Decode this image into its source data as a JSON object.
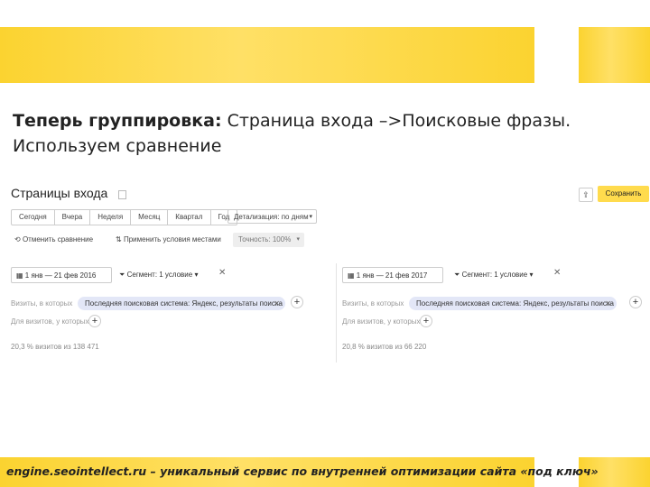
{
  "heading": {
    "bold": "Теперь группировка:",
    "rest": " Страница входа –>Поисковые фразы.",
    "line2": "Используем сравнение"
  },
  "report": {
    "title": "Страницы входа",
    "share_icon": "share-icon",
    "save_label": "Сохранить",
    "periods": [
      "Сегодня",
      "Вчера",
      "Неделя",
      "Месяц",
      "Квартал",
      "Год"
    ],
    "detail_select": "Детализация: по дням",
    "compare_label": "Отменить сравнение",
    "apply_label": "Применить условия местами",
    "accuracy_label": "Точность: 100%",
    "left": {
      "date": "1 янв — 21 фев 2016",
      "segment": "Сегмент: 1 условие",
      "visit_label": "Визиты, в которых",
      "chip": "Последняя поисковая система: Яндекс, результаты поиска",
      "visits_label": "Для визитов, у которых",
      "summary": "20,3 % визитов из 138 471"
    },
    "right": {
      "date": "1 янв — 21 фев 2017",
      "segment": "Сегмент: 1 условие",
      "visit_label": "Визиты, в которых",
      "chip": "Последняя поисковая система: Яндекс, результаты поиска",
      "visits_label": "Для визитов, у которых",
      "summary": "20,8 % визитов из 66 220"
    }
  },
  "footer": "engine.seointellect.ru – уникальный сервис по внутренней оптимизации сайта «под ключ»",
  "colors": {
    "accent": "#fbd330",
    "save": "#ffdb4d",
    "chip": "#e3e7f7"
  }
}
